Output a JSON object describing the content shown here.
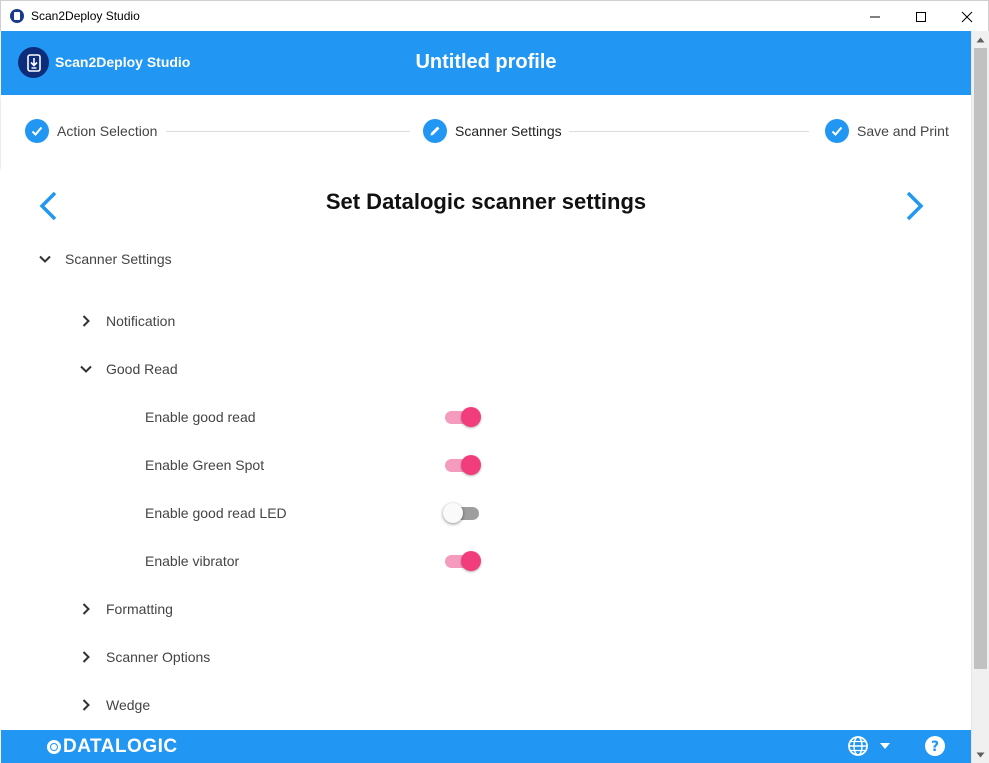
{
  "window": {
    "title": "Scan2Deploy Studio",
    "icons": {
      "minimize": "minimize-icon",
      "maximize": "maximize-icon",
      "close": "close-icon"
    }
  },
  "header": {
    "brand": "Scan2Deploy Studio",
    "profile_title": "Untitled profile",
    "color": "#2196f3"
  },
  "stepper": {
    "steps": [
      {
        "label": "Action Selection",
        "icon": "check-icon",
        "state": "completed"
      },
      {
        "label": "Scanner Settings",
        "icon": "pencil-icon",
        "state": "active"
      },
      {
        "label": "Save and Print",
        "icon": "check-icon",
        "state": "completed"
      }
    ]
  },
  "main": {
    "heading": "Set Datalogic scanner settings",
    "tree": {
      "root": {
        "label": "Scanner Settings",
        "expanded": true
      },
      "groups": [
        {
          "label": "Notification",
          "expanded": false
        },
        {
          "label": "Good Read",
          "expanded": true
        },
        {
          "label": "Formatting",
          "expanded": false
        },
        {
          "label": "Scanner Options",
          "expanded": false
        },
        {
          "label": "Wedge",
          "expanded": false
        }
      ],
      "good_read_settings": [
        {
          "label": "Enable good read",
          "enabled": true
        },
        {
          "label": "Enable Green Spot",
          "enabled": true
        },
        {
          "label": "Enable good read LED",
          "enabled": false
        },
        {
          "label": "Enable vibrator",
          "enabled": true
        }
      ]
    },
    "toggle_on_color": "#f23d7c"
  },
  "footer": {
    "logo": "DATALOGIC",
    "icons": [
      "globe-icon",
      "caret-down-icon",
      "help-icon"
    ]
  }
}
